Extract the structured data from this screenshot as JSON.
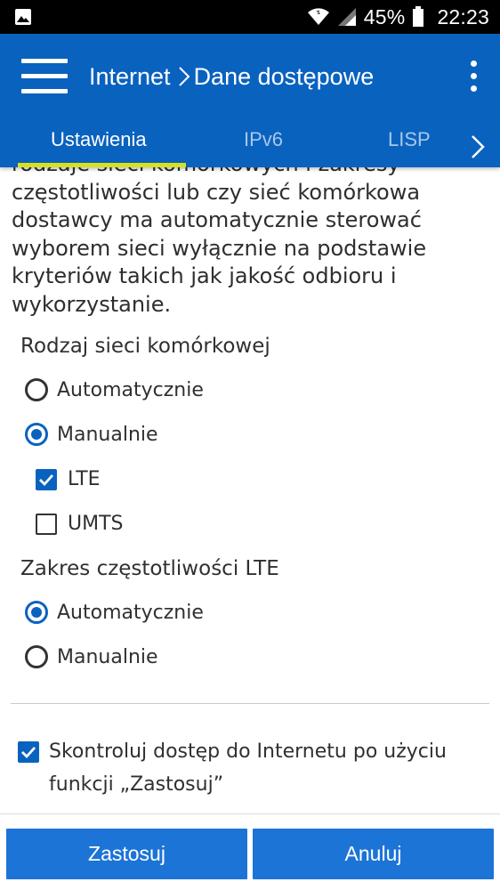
{
  "status": {
    "battery": "45%",
    "time": "22:23"
  },
  "appbar": {
    "title_part1": "Internet",
    "title_part2": "Dane dostępowe",
    "tabs": [
      {
        "label": "Ustawienia"
      },
      {
        "label": "IPv6"
      },
      {
        "label": "LISP"
      }
    ]
  },
  "content": {
    "description": "rodzaje sieci komórkowych i zakresy częstotliwości lub czy sieć komórkowa dostawcy ma automatycznie sterować wyborem sieci wyłącznie na podstawie kryteriów takich jak jakość odbioru i wykorzystanie.",
    "network_type": {
      "label": "Rodzaj sieci komórkowej",
      "options": [
        {
          "label": "Automatycznie",
          "selected": false
        },
        {
          "label": "Manualnie",
          "selected": true
        }
      ],
      "checks": [
        {
          "label": "LTE",
          "checked": true
        },
        {
          "label": "UMTS",
          "checked": false
        }
      ]
    },
    "lte_band": {
      "label": "Zakres częstotliwości LTE",
      "options": [
        {
          "label": "Automatycznie",
          "selected": true
        },
        {
          "label": "Manualnie",
          "selected": false
        }
      ]
    },
    "verify_check": {
      "label": "Skontroluj dostęp do Internetu po użyciu funkcji „Zastosuj”",
      "checked": true
    }
  },
  "buttons": {
    "apply": "Zastosuj",
    "cancel": "Anuluj"
  },
  "colors": {
    "accent": "#0a62bf",
    "tab_indicator": "#d6e21a",
    "button": "#1c74d6"
  }
}
